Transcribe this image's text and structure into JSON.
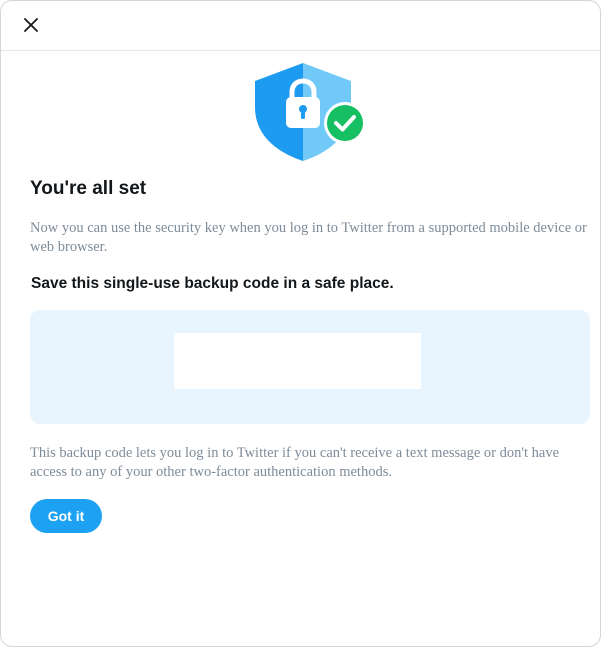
{
  "dialog": {
    "title": "You're all set",
    "description": "Now you can use the security key when you log in to Twitter from a supported mobile device or web browser.",
    "save_heading": "Save this single-use backup code in a safe place.",
    "backup_code": "",
    "footnote": "This backup code lets you log in to Twitter if you can't receive a text message or don't have access to any of your other two-factor authentication methods.",
    "got_it_label": "Got it"
  },
  "icons": {
    "close": "close-icon",
    "illustration": "shield-lock-check-icon"
  },
  "colors": {
    "accent": "#1da1f2",
    "shield_dark": "#1d9bf0",
    "shield_light": "#71c9f8",
    "check": "#17bf63",
    "code_panel": "#e8f5fe",
    "muted_text": "#7e8c99",
    "heading_text": "#14171a"
  }
}
